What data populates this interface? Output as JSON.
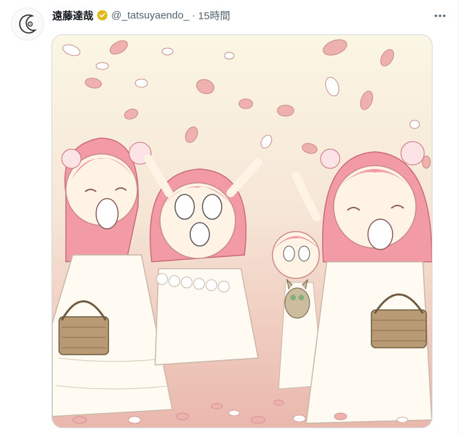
{
  "tweet": {
    "author_name": "遠藤達哉",
    "handle": "@_tatsuyaendo_",
    "separator": "·",
    "time": "15時間",
    "verified_badge_icon": "verified-badge-icon",
    "more_icon": "more-options-icon",
    "avatar_icon": "moon-avatar-icon",
    "image_alt": "Illustration of girls in white dresses throwing flower petals"
  },
  "colors": {
    "name": "#0f1419",
    "meta": "#536471",
    "badge": "#e2b719",
    "border": "#cfd9de",
    "petal": "#eeb1ad",
    "hair": "#f29aa6"
  }
}
